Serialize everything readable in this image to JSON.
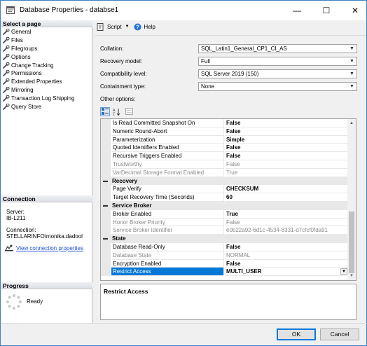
{
  "window": {
    "title": "Database Properties - databse1"
  },
  "titlebar": {
    "minimize": "—",
    "maximize": "☐",
    "close": "✕"
  },
  "left_panel": {
    "select_page_header": "Select a page",
    "pages": [
      "General",
      "Files",
      "Filegroups",
      "Options",
      "Change Tracking",
      "Permissions",
      "Extended Properties",
      "Mirroring",
      "Transaction Log Shipping",
      "Query Store"
    ],
    "connection_header": "Connection",
    "server_label": "Server:",
    "server_value": "IB-L211",
    "connection_label": "Connection:",
    "connection_value": "STELLARINFO\\monika.dadool",
    "view_connection_link": "View connection properties",
    "progress_header": "Progress",
    "progress_status": "Ready"
  },
  "toolbar": {
    "script_label": "Script",
    "help_label": "Help"
  },
  "form": {
    "collation_label": "Collation:",
    "collation_value": "SQL_Latin1_General_CP1_CI_AS",
    "recovery_label": "Recovery model:",
    "recovery_value": "Full",
    "compat_label": "Compatibility level:",
    "compat_value": "SQL Server 2019 (150)",
    "containment_label": "Containment type:",
    "containment_value": "None",
    "other_options_label": "Other options:"
  },
  "grid": {
    "rows_top": [
      {
        "name": "Is Read Committed Snapshot On",
        "value": "False",
        "bold": true,
        "disabled": false
      },
      {
        "name": "Numeric Round-Abort",
        "value": "False",
        "bold": true,
        "disabled": false
      },
      {
        "name": "Parameterization",
        "value": "Simple",
        "bold": true,
        "disabled": false
      },
      {
        "name": "Quoted Identifiers Enabled",
        "value": "False",
        "bold": true,
        "disabled": false
      },
      {
        "name": "Recursive Triggers Enabled",
        "value": "False",
        "bold": true,
        "disabled": false
      },
      {
        "name": "Trustworthy",
        "value": "False",
        "bold": false,
        "disabled": true
      },
      {
        "name": "VarDecimal Storage Format Enabled",
        "value": "True",
        "bold": false,
        "disabled": true
      }
    ],
    "cat_recovery": "Recovery",
    "rows_recovery": [
      {
        "name": "Page Verify",
        "value": "CHECKSUM",
        "bold": true,
        "disabled": false
      },
      {
        "name": "Target Recovery Time (Seconds)",
        "value": "60",
        "bold": true,
        "disabled": false
      }
    ],
    "cat_broker": "Service Broker",
    "rows_broker": [
      {
        "name": "Broker Enabled",
        "value": "True",
        "bold": true,
        "disabled": false
      },
      {
        "name": "Honor Broker Priority",
        "value": "False",
        "bold": false,
        "disabled": true
      },
      {
        "name": "Service Broker Identifier",
        "value": "e0b22a92-6d1c-4534-8331-d7cfcf0fda91",
        "bold": false,
        "disabled": true
      }
    ],
    "cat_state": "State",
    "rows_state": [
      {
        "name": "Database Read-Only",
        "value": "False",
        "bold": true,
        "disabled": false
      },
      {
        "name": "Database State",
        "value": "NORMAL",
        "bold": false,
        "disabled": true
      },
      {
        "name": "Encryption Enabled",
        "value": "False",
        "bold": true,
        "disabled": false
      },
      {
        "name": "Restrict Access",
        "value": "MULTI_USER",
        "bold": true,
        "disabled": false,
        "selected": true
      }
    ],
    "toggle_symbol": "▬"
  },
  "description": {
    "title": "Restrict Access"
  },
  "buttons": {
    "ok": "OK",
    "cancel": "Cancel"
  },
  "colors": {
    "selection": "#0078d7",
    "link": "#1f4fd6",
    "window_border": "#3c83c4"
  }
}
